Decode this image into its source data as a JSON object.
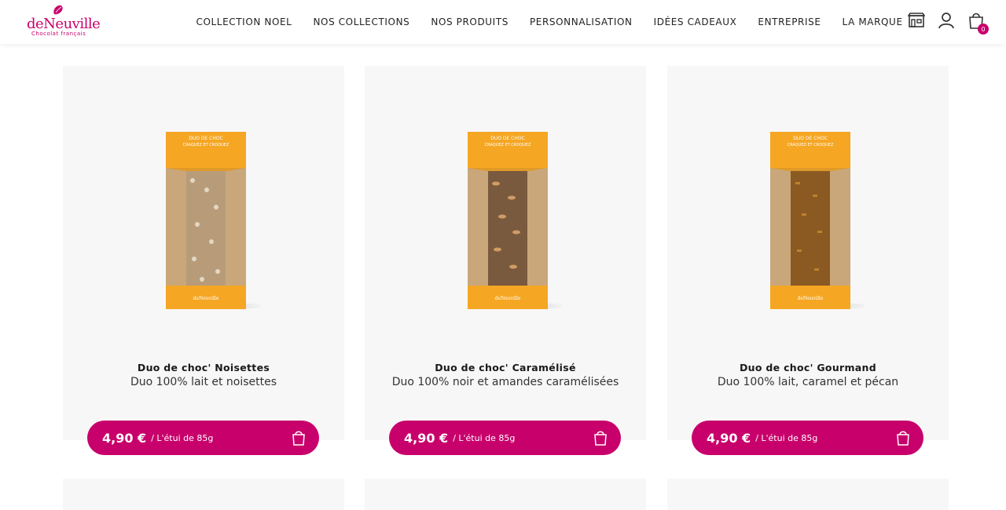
{
  "brand": {
    "name": "deNeuville",
    "tagline": "Chocolat français"
  },
  "nav": [
    "COLLECTION NOEL",
    "NOS COLLECTIONS",
    "NOS PRODUITS",
    "PERSONNALISATION",
    "IDÉES CADEAUX",
    "ENTREPRISE",
    "LA MARQUE"
  ],
  "header_icons": {
    "store": "store-icon",
    "account": "user-icon",
    "cart": "shopping-bag-icon",
    "cart_count": "0"
  },
  "colors": {
    "accent": "#c8006b",
    "card_bg": "#f8f7f8",
    "box_orange": "#f5a623",
    "box_kraft": "#c9a77a"
  },
  "packaging": {
    "line1": "DUO DE CHOC",
    "line2": "CRAQUEZ ET CROQUEZ",
    "logo": "deNeuville"
  },
  "products": [
    {
      "title": "Duo de choc' Noisettes",
      "subtitle": "Duo 100% lait et noisettes",
      "price": "4,90 €",
      "unit": "/ L'étui de 85g",
      "filling": "#b89c7a"
    },
    {
      "title": "Duo de choc' Caramélisé",
      "subtitle": "Duo 100% noir et amandes caramélisées",
      "price": "4,90 €",
      "unit": "/ L'étui de 85g",
      "filling": "#7a5a3e"
    },
    {
      "title": "Duo de choc' Gourmand",
      "subtitle": "Duo 100% lait, caramel et pécan",
      "price": "4,90 €",
      "unit": "/ L'étui de 85g",
      "filling": "#8a5a22"
    }
  ]
}
